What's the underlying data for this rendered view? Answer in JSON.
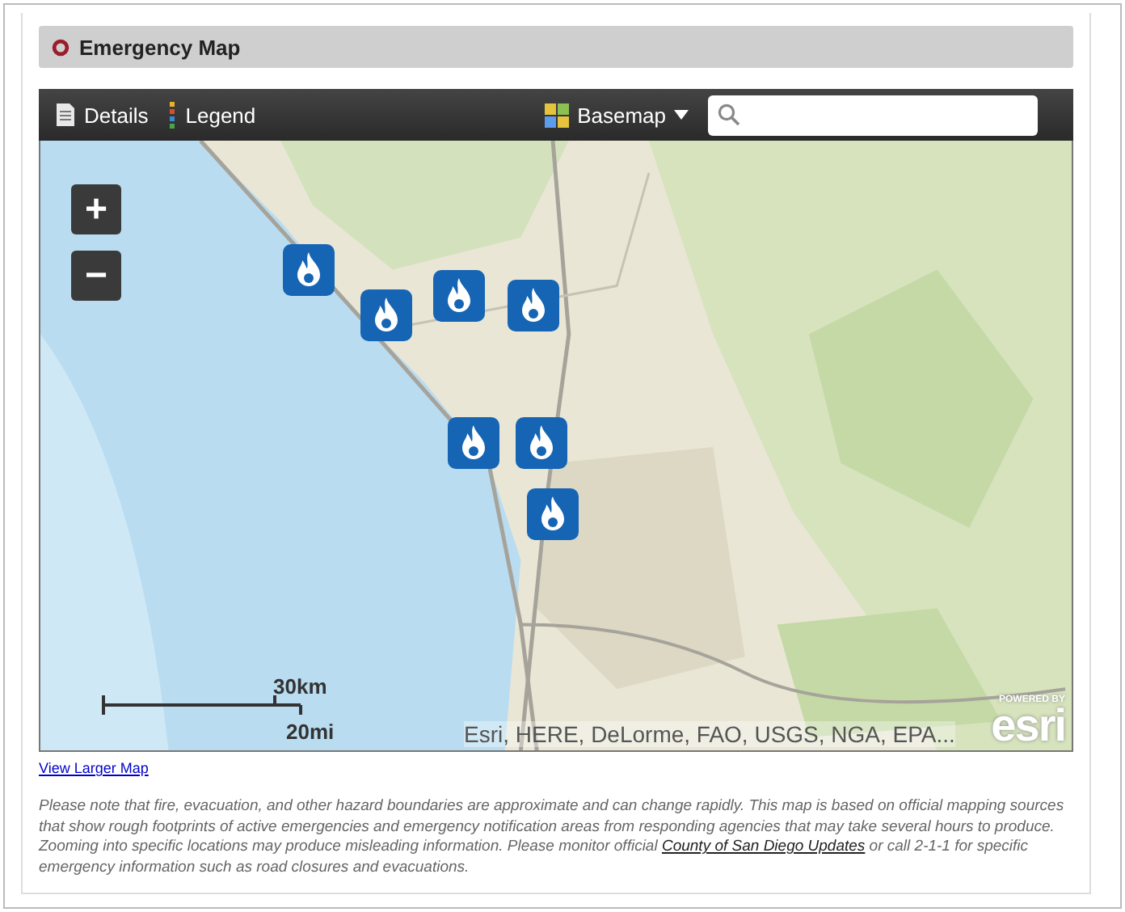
{
  "panel": {
    "title": "Emergency Map"
  },
  "toolbar": {
    "details": "Details",
    "legend": "Legend",
    "basemap": "Basemap"
  },
  "map": {
    "kind": "picture",
    "zoom_in": "+",
    "zoom_out": "−",
    "scale": {
      "metric": "30km",
      "imperial": "20mi"
    },
    "attribution": "Esri, HERE, DeLorme, FAO, USGS, NGA, EPA...",
    "logo": {
      "caption": "POWERED BY",
      "name": "esri"
    },
    "markers": [
      {
        "kind": "fire"
      },
      {
        "kind": "fire"
      },
      {
        "kind": "fire"
      },
      {
        "kind": "fire"
      },
      {
        "kind": "fire"
      },
      {
        "kind": "fire"
      },
      {
        "kind": "fire"
      }
    ]
  },
  "link": "View Larger Map",
  "note": {
    "before": "Please note that fire, evacuation, and other hazard boundaries are approximate and can change rapidly.  This map is based on official mapping sources that show rough footprints of active emergencies and emergency notification areas from responding agencies that may take several hours to produce.  Zooming into specific locations may produce misleading information. Please monitor official ",
    "link": "County of San Diego Updates",
    "after": " or call 2-1-1 for specific emergency information such as road closures and evacuations."
  }
}
